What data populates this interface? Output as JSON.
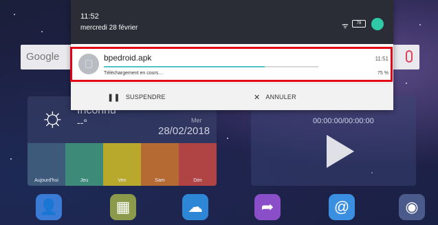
{
  "status_bar": {
    "time": "11:52",
    "date": "mercredi 28 février",
    "battery": "78",
    "wifi_icon": "wifi-icon",
    "avatar_icon": "user-avatar-icon"
  },
  "search": {
    "logo_text": "Google",
    "mic_icon": "mic-icon"
  },
  "notification": {
    "title": "bpedroid.apk",
    "time": "11:51",
    "status": "Téléchargement en cours…",
    "percent_text": "75 %",
    "progress": 0.75,
    "icon": "download-file-icon",
    "actions": {
      "pause": {
        "icon": "pause-icon",
        "label": "SUSPENDRE"
      },
      "cancel": {
        "icon": "close-icon",
        "label": "ANNULER"
      }
    }
  },
  "weather": {
    "city": "Inconnu",
    "temp": "--°",
    "day": "Mer",
    "date": "28/02/2018",
    "sun_icon": "sun-icon",
    "days": [
      {
        "label": "Aujourd'hui",
        "color": "#3d5a7a"
      },
      {
        "label": "Jeu",
        "color": "#3e8a78"
      },
      {
        "label": "Ven",
        "color": "#b8a82c"
      },
      {
        "label": "Sam",
        "color": "#b56a34"
      },
      {
        "label": "Dim",
        "color": "#b04344"
      }
    ]
  },
  "music": {
    "time": "00:00:00/00:00:00",
    "play_icon": "play-icon"
  },
  "dock": [
    {
      "icon": "contacts-icon",
      "color": "#3a7bd5"
    },
    {
      "icon": "gallery-icon",
      "color": "#8a9a4a"
    },
    {
      "icon": "cloud-icon",
      "color": "#2e86d6"
    },
    {
      "icon": "share-icon",
      "color": "#8a4fc8"
    },
    {
      "icon": "email-icon",
      "color": "#3b8fe0"
    },
    {
      "icon": "camera-icon",
      "color": "#4a5a8a"
    }
  ]
}
